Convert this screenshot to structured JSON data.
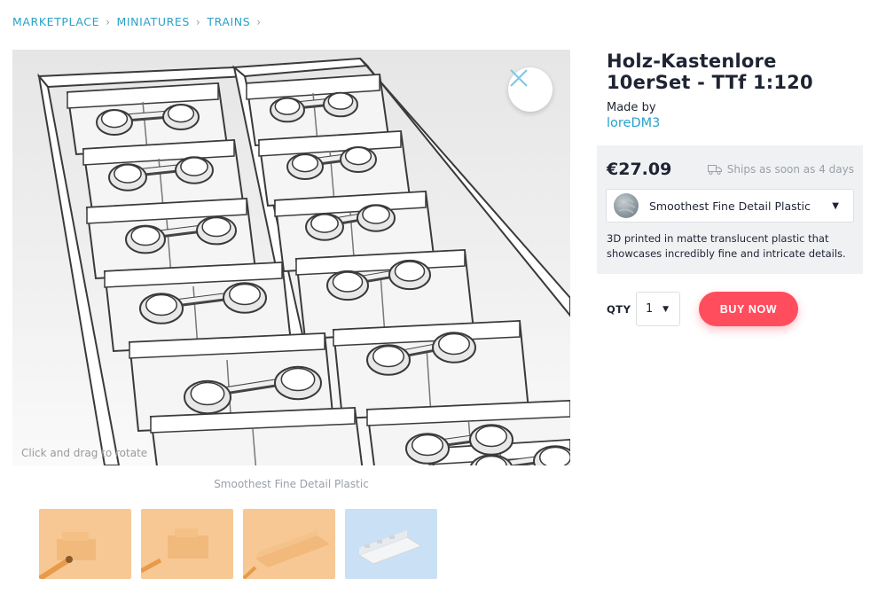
{
  "breadcrumb": [
    {
      "label": "MARKETPLACE"
    },
    {
      "label": "MINIATURES"
    },
    {
      "label": "TRAINS"
    }
  ],
  "viewer": {
    "rotate_hint": "Click and drag to rotate",
    "close_icon": "close-icon"
  },
  "caption": "Smoothest Fine Detail Plastic",
  "thumbnails": [
    {
      "name": "thumb-orange-1",
      "color": "#f7c894"
    },
    {
      "name": "thumb-orange-2",
      "color": "#f7c894"
    },
    {
      "name": "thumb-orange-3",
      "color": "#f7c894"
    },
    {
      "name": "thumb-blue",
      "color": "#c9e0f5"
    }
  ],
  "product": {
    "title": "Holz-Kastenlore 10erSet - TTf 1:120",
    "made_by_label": "Made by",
    "author": "loreDM3"
  },
  "purchase": {
    "price": "€27.09",
    "ships_text": "Ships as soon as 4 days",
    "material_name": "Smoothest Fine Detail Plastic",
    "material_desc": "3D printed in matte translucent plastic that showcases incredibly fine and intricate details.",
    "qty_label": "QTY",
    "qty_value": "1",
    "buy_label": "BUY NOW"
  },
  "colors": {
    "accent": "#2aa1c9",
    "buy": "#ff4d5e",
    "panel": "#f0f1f3"
  }
}
